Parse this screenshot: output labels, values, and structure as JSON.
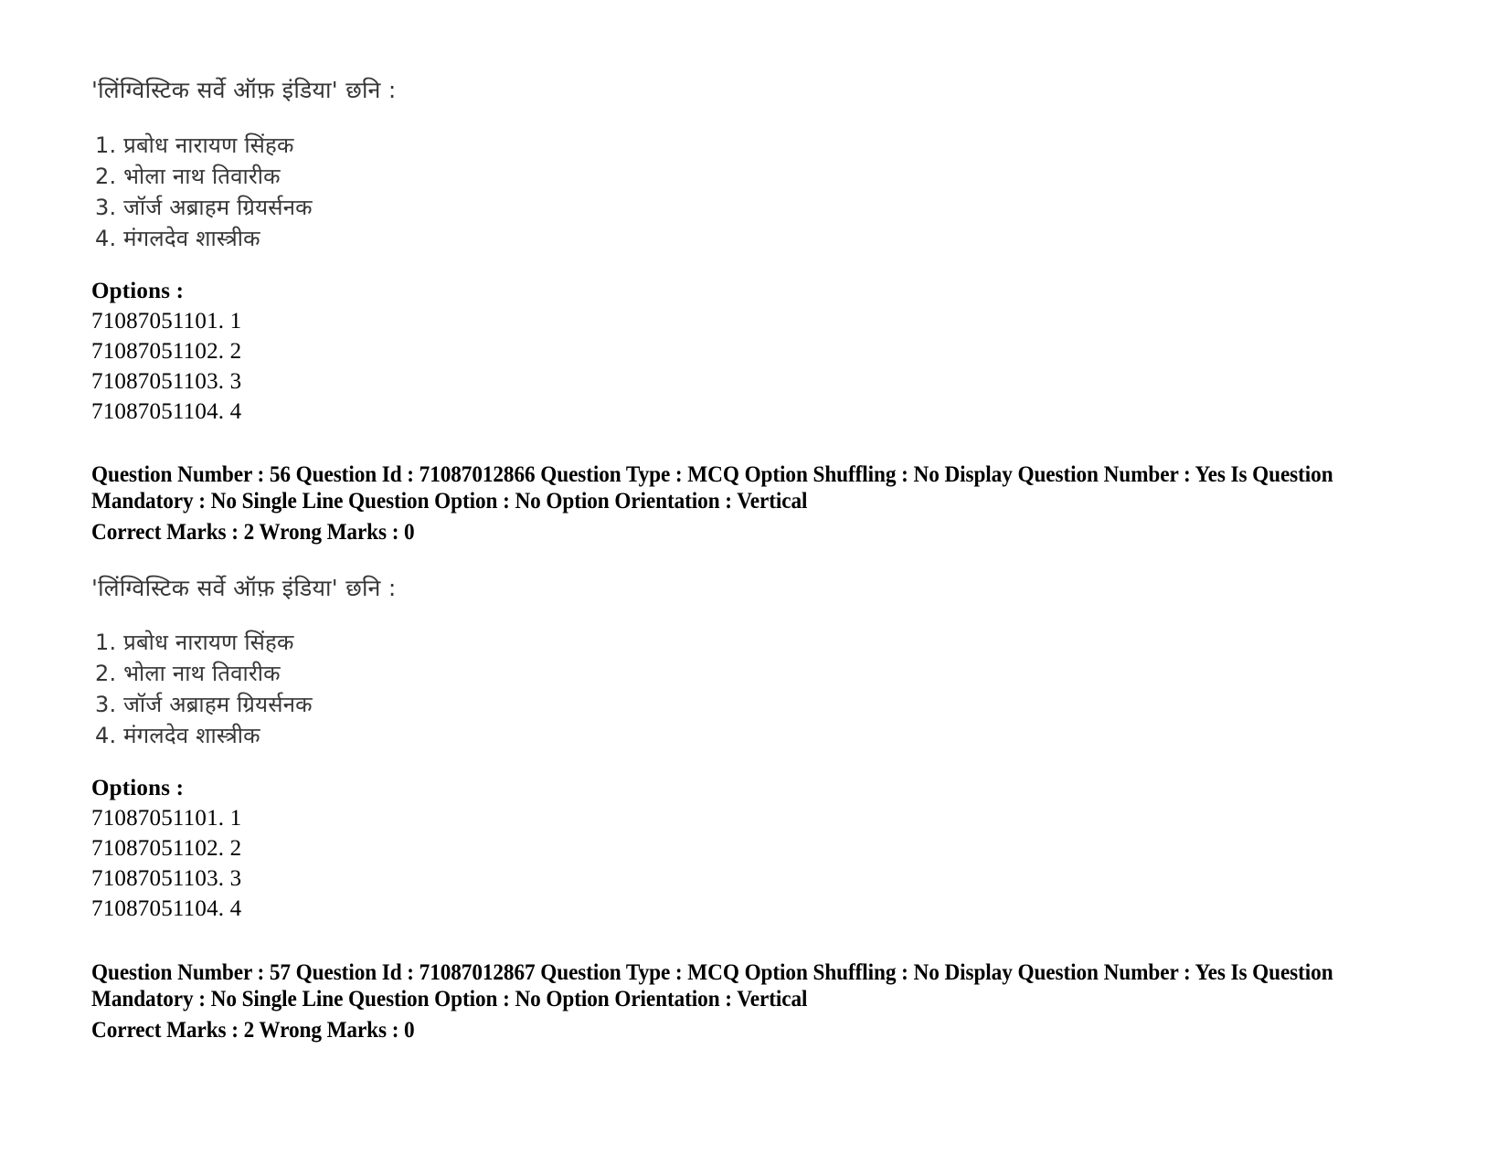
{
  "document": {
    "type": "scanned-exam-question-paper",
    "background_color": "#ffffff",
    "text_color": "#000000"
  },
  "questions": [
    {
      "heading": "'लिंग्विस्टिक सर्वे ऑफ़ इंडिया' छनि :",
      "items": [
        "1. प्रबोध नारायण सिंहक",
        "2. भोला नाथ तिवारीक",
        "3. जॉर्ज अब्राहम ग्रियर्सनक",
        "4. मंगलदेव शास्त्रीक"
      ],
      "options_label": "Options :",
      "options": [
        "71087051101. 1",
        "71087051102. 2",
        "71087051103. 3",
        "71087051104. 4"
      ]
    },
    {
      "heading": "'लिंग्विस्टिक सर्वे ऑफ़ इंडिया' छनि :",
      "items": [
        "1. प्रबोध नारायण सिंहक",
        "2. भोला नाथ तिवारीक",
        "3. जॉर्ज अब्राहम ग्रियर्सनक",
        "4. मंगलदेव शास्त्रीक"
      ],
      "options_label": "Options :",
      "options": [
        "71087051101. 1",
        "71087051102. 2",
        "71087051103. 3",
        "71087051104. 4"
      ]
    }
  ],
  "metadata_blocks": [
    {
      "line1": "Question Number : 56 Question Id : 71087012866 Question Type : MCQ Option Shuffling : No Display Question Number : Yes Is Question Mandatory : No Single Line Question Option : No Option Orientation : Vertical",
      "line2": "Correct Marks : 2 Wrong Marks : 0",
      "fields": {
        "question_number": "56",
        "question_id": "71087012866",
        "question_type": "MCQ",
        "option_shuffling": "No",
        "display_question_number": "Yes",
        "is_question_mandatory": "No",
        "single_line_question_option": "No",
        "option_orientation": "Vertical",
        "correct_marks": "2",
        "wrong_marks": "0"
      }
    },
    {
      "line1": "Question Number : 57 Question Id : 71087012867 Question Type : MCQ Option Shuffling : No Display Question Number : Yes Is Question Mandatory : No Single Line Question Option : No Option Orientation : Vertical",
      "line2": "Correct Marks : 2 Wrong Marks : 0",
      "fields": {
        "question_number": "57",
        "question_id": "71087012867",
        "question_type": "MCQ",
        "option_shuffling": "No",
        "display_question_number": "Yes",
        "is_question_mandatory": "No",
        "single_line_question_option": "No",
        "option_orientation": "Vertical",
        "correct_marks": "2",
        "wrong_marks": "0"
      }
    }
  ]
}
